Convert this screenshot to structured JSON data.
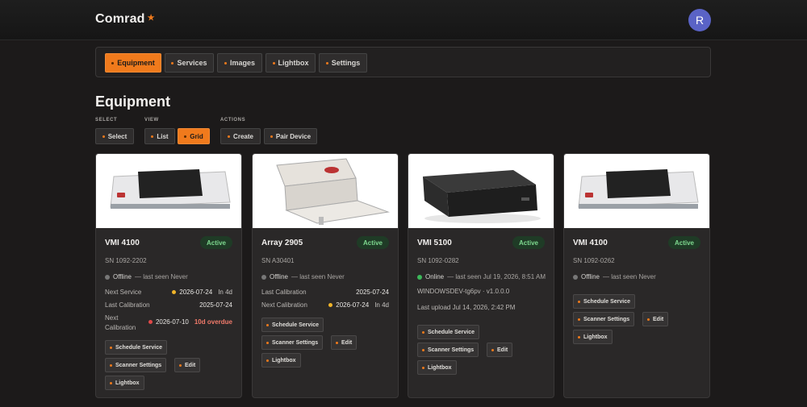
{
  "app": {
    "title": "Comrad",
    "user_initial": "R"
  },
  "colors": {
    "accent": "#f07a1c",
    "active_badge_bg": "#1f3b26",
    "active_badge_text": "#7ed88f",
    "online": "#3cb85a",
    "offline": "#777777",
    "warning": "#f0b429",
    "error": "#e04848"
  },
  "nav": {
    "tabs": [
      {
        "label": "Equipment",
        "active": true
      },
      {
        "label": "Services",
        "active": false
      },
      {
        "label": "Images",
        "active": false
      },
      {
        "label": "Lightbox",
        "active": false
      },
      {
        "label": "Settings",
        "active": false
      }
    ]
  },
  "page": {
    "title": "Equipment",
    "groups": {
      "select": "SELECT",
      "view": "VIEW",
      "actions": "ACTIONS"
    },
    "buttons": {
      "select": "Select",
      "list": "List",
      "grid": "Grid",
      "create": "Create",
      "pair_device": "Pair Device"
    },
    "active_view": "Grid"
  },
  "cards": [
    {
      "name": "VMI 4100",
      "badge": "Active",
      "serial": "SN 1092-2202",
      "status": "Offline",
      "last_seen": "— last seen Never",
      "rows": [
        {
          "label": "Next Service",
          "value": "2026-07-24",
          "rel": "In 4d",
          "dot": "warn"
        },
        {
          "label": "Last Calibration",
          "value": "2025-07-24"
        },
        {
          "label": "Next Calibration",
          "value": "2026-07-10",
          "rel": "10d overdue",
          "dot": "err"
        }
      ],
      "actions": {
        "schedule": "Schedule Service",
        "scanner": "Scanner Settings",
        "edit": "Edit",
        "lightbox": "Lightbox"
      }
    },
    {
      "name": "Array 2905",
      "badge": "Active",
      "serial": "SN A30401",
      "status": "Offline",
      "last_seen": "— last seen Never",
      "rows": [
        {
          "label": "Last Calibration",
          "value": "2025-07-24"
        },
        {
          "label": "Next Calibration",
          "value": "2026-07-24",
          "rel": "In 4d",
          "dot": "warn"
        }
      ],
      "actions": {
        "schedule": "Schedule Service",
        "scanner": "Scanner Settings",
        "edit": "Edit",
        "lightbox": "Lightbox"
      }
    },
    {
      "name": "VMI 5100",
      "badge": "Active",
      "serial": "SN 1092-0282",
      "status": "Online",
      "last_seen": "— last seen Jul 19, 2026, 8:51 AM",
      "device": "WINDOWSDEV-tg6pv · v1.0.0.0",
      "last_upload": "Last upload Jul 14, 2026, 2:42 PM",
      "actions": {
        "schedule": "Schedule Service",
        "scanner": "Scanner Settings",
        "edit": "Edit",
        "lightbox": "Lightbox"
      }
    },
    {
      "name": "VMI 4100",
      "badge": "Active",
      "serial": "SN 1092-0262",
      "status": "Offline",
      "last_seen": "— last seen Never",
      "actions": {
        "schedule": "Schedule Service",
        "scanner": "Scanner Settings",
        "edit": "Edit",
        "lightbox": "Lightbox"
      }
    }
  ]
}
